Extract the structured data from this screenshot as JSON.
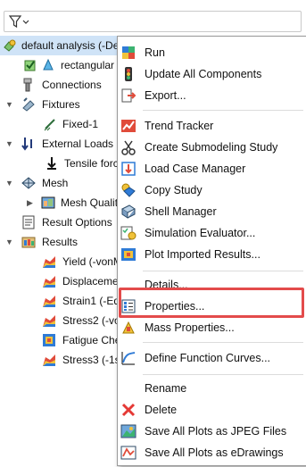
{
  "tree": {
    "root": "default analysis (-Def",
    "part": "rectangular",
    "connections": "Connections",
    "fixtures": "Fixtures",
    "fixed": "Fixed-1",
    "external_loads": "External Loads",
    "tensile": "Tensile force",
    "mesh": "Mesh",
    "mesh_quality": "Mesh Qualit",
    "result_options": "Result Options",
    "results": "Results",
    "yield": "Yield (-vonM",
    "displacement": "Displaceme",
    "strain": "Strain1 (-Eq",
    "stress2": "Stress2 (-vo",
    "fatigue": "Fatigue Che",
    "stress3": "Stress3 (-1st"
  },
  "menu": {
    "items": [
      {
        "label": "Run",
        "icon": "run-icon"
      },
      {
        "label": "Update All Components",
        "icon": "traffic-light-icon"
      },
      {
        "label": "Export...",
        "icon": "export-icon"
      },
      {
        "label": "Trend Tracker",
        "icon": "trend-tracker-icon"
      },
      {
        "label": "Create Submodeling Study",
        "icon": "scissors-icon"
      },
      {
        "label": "Load Case Manager",
        "icon": "load-case-icon"
      },
      {
        "label": "Copy Study",
        "icon": "copy-study-icon"
      },
      {
        "label": "Shell Manager",
        "icon": "shell-manager-icon"
      },
      {
        "label": "Simulation Evaluator...",
        "icon": "evaluator-icon"
      },
      {
        "label": "Plot Imported Results...",
        "icon": "plot-import-icon"
      },
      {
        "label": "Details...",
        "icon": "none"
      },
      {
        "label": "Properties...",
        "icon": "properties-icon"
      },
      {
        "label": "Mass Properties...",
        "icon": "mass-properties-icon"
      },
      {
        "label": "Define Function Curves...",
        "icon": "function-curve-icon"
      },
      {
        "label": "Rename",
        "icon": "none"
      },
      {
        "label": "Delete",
        "icon": "delete-icon"
      },
      {
        "label": "Save All Plots as JPEG Files",
        "icon": "jpeg-icon"
      },
      {
        "label": "Save All Plots as eDrawings",
        "icon": "edrawings-icon"
      }
    ]
  },
  "colors": {
    "highlight": "#e34b4b",
    "selection": "#cfe3f7"
  }
}
